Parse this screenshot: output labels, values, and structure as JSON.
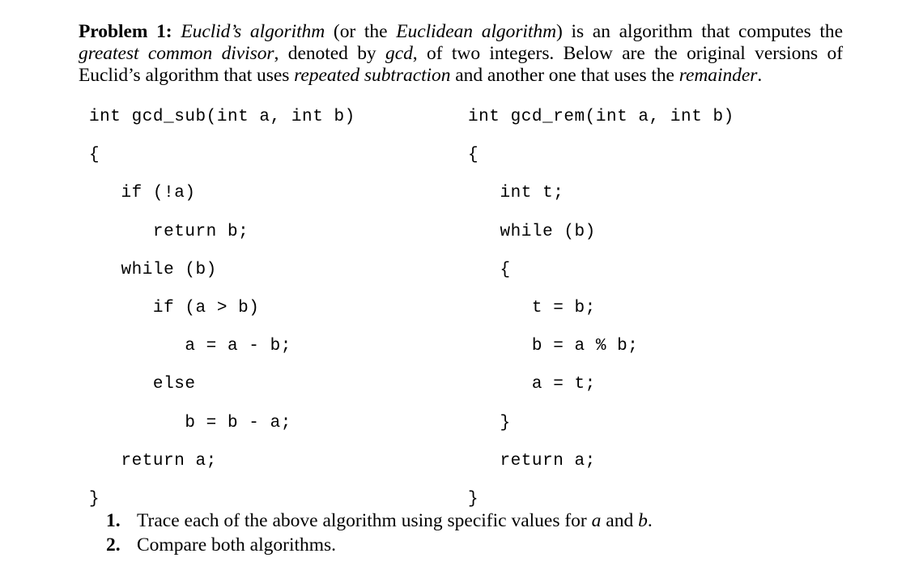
{
  "document": {
    "problem_label": "Problem 1:",
    "intro_segments": [
      {
        "text": "Problem 1:",
        "style": "bold"
      },
      {
        "text": " ",
        "style": "normal"
      },
      {
        "text": "Euclid’s algorithm",
        "style": "italic"
      },
      {
        "text": " (or the ",
        "style": "normal"
      },
      {
        "text": "Euclidean algorithm",
        "style": "italic"
      },
      {
        "text": ") is an algorithm that computes the ",
        "style": "normal"
      },
      {
        "text": "greatest common divisor",
        "style": "italic"
      },
      {
        "text": ", denoted by ",
        "style": "normal"
      },
      {
        "text": "gcd",
        "style": "italic"
      },
      {
        "text": ", of two integers. Below are the original versions of Euclid’s algorithm that uses ",
        "style": "normal"
      },
      {
        "text": "repeated subtraction",
        "style": "italic"
      },
      {
        "text": " and another one that uses the ",
        "style": "normal"
      },
      {
        "text": "remainder",
        "style": "italic"
      },
      {
        "text": ".",
        "style": "normal"
      }
    ]
  },
  "code_blocks": {
    "left": {
      "function_name": "gcd_sub",
      "signature": "int gcd_sub(int a, int b)",
      "lines": [
        "int gcd_sub(int a, int b)",
        "{",
        "   if (!a)",
        "      return b;",
        "   while (b)",
        "      if (a > b)",
        "         a = a - b;",
        "      else",
        "         b = b - a;",
        "   return a;",
        "}"
      ]
    },
    "right": {
      "function_name": "gcd_rem",
      "signature": "int gcd_rem(int a, int b)",
      "lines": [
        "int gcd_rem(int a, int b)",
        "{",
        "   int t;",
        "   while (b)",
        "   {",
        "      t = b;",
        "      b = a % b;",
        "      a = t;",
        "   }",
        "   return a;",
        "}"
      ]
    }
  },
  "tasks": [
    {
      "number": "1.",
      "segments": [
        {
          "text": "Trace each of the above algorithm using specific values for ",
          "style": "normal"
        },
        {
          "text": "a",
          "style": "italic"
        },
        {
          "text": " and ",
          "style": "normal"
        },
        {
          "text": "b",
          "style": "italic"
        },
        {
          "text": ".",
          "style": "normal"
        }
      ]
    },
    {
      "number": "2.",
      "segments": [
        {
          "text": "Compare both algorithms.",
          "style": "normal"
        }
      ]
    }
  ],
  "colors": {
    "page_background": "#ffffff",
    "text": "#000000"
  }
}
